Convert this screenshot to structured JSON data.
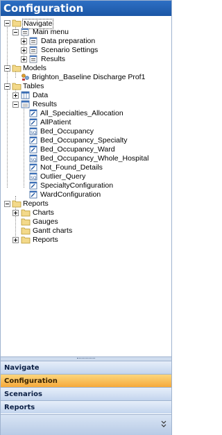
{
  "header": {
    "title": "Configuration"
  },
  "tree": {
    "navigate": "Navigate",
    "main_menu": "Main menu",
    "data_preparation": "Data preparation",
    "scenario_settings": "Scenario Settings",
    "results_menu": "Results",
    "models": "Models",
    "model_item": "Brighton_Baseline Discharge Prof1",
    "tables": "Tables",
    "data": "Data",
    "results": "Results",
    "result_items": [
      "All_Specialties_Allocation",
      "AllPatient",
      "Bed_Occupancy",
      "Bed_Occupancy_Specialty",
      "Bed_Occupancy_Ward",
      "Bed_Occupancy_Whole_Hospital",
      "Not_Found_Details",
      "Outlier_Query",
      "SpecialtyConfiguration",
      "WardConfiguration"
    ],
    "reports": "Reports",
    "charts": "Charts",
    "gauges": "Gauges",
    "gantt_charts": "Gantt charts",
    "reports_sub": "Reports"
  },
  "nav_buttons": {
    "navigate": "Navigate",
    "configuration": "Configuration",
    "scenarios": "Scenarios",
    "reports": "Reports"
  },
  "colors": {
    "header": "#1f5fb3",
    "active_button": "#f6b24a",
    "button": "#d3e0f2"
  },
  "icons": [
    "folder-icon",
    "menu-icon",
    "table-icon",
    "query-icon",
    "model-icon",
    "chevron-down-icon"
  ]
}
